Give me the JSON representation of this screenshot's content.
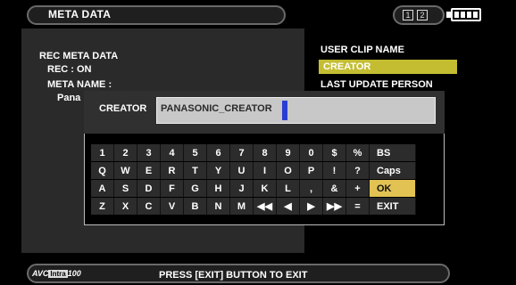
{
  "header": {
    "title": "META DATA",
    "slots": [
      "1",
      "2"
    ]
  },
  "left": {
    "section_title": "REC META DATA",
    "rec_status": "REC : ON",
    "meta_name": "META NAME :",
    "meta_name_value": "Pana"
  },
  "right": {
    "items": [
      "USER CLIP NAME",
      "CREATOR",
      "LAST UPDATE PERSON"
    ],
    "selected_index": 1
  },
  "dialog": {
    "field_label": "CREATOR",
    "field_value": "PANASONIC_CREATOR",
    "keyboard_rows": [
      [
        "1",
        "2",
        "3",
        "4",
        "5",
        "6",
        "7",
        "8",
        "9",
        "0",
        "$",
        "%",
        "BS"
      ],
      [
        "Q",
        "W",
        "E",
        "R",
        "T",
        "Y",
        "U",
        "I",
        "O",
        "P",
        "!",
        "?",
        "Caps"
      ],
      [
        "A",
        "S",
        "D",
        "F",
        "G",
        "H",
        "J",
        "K",
        "L",
        ",",
        "&",
        "+",
        "OK"
      ],
      [
        "Z",
        "X",
        "C",
        "V",
        "B",
        "N",
        "M",
        "◀◀",
        "◀",
        "▶",
        "▶▶",
        "=",
        "EXIT"
      ]
    ],
    "highlighted_key": "OK"
  },
  "footer": {
    "logo_prefix": "AVC",
    "logo_intra": "Intra",
    "logo_number": "100",
    "message": "PRESS [EXIT] BUTTON TO EXIT"
  },
  "colors": {
    "selection": "#c4bd32",
    "key_highlight": "#e2c252",
    "caret": "#2a3fd1"
  }
}
